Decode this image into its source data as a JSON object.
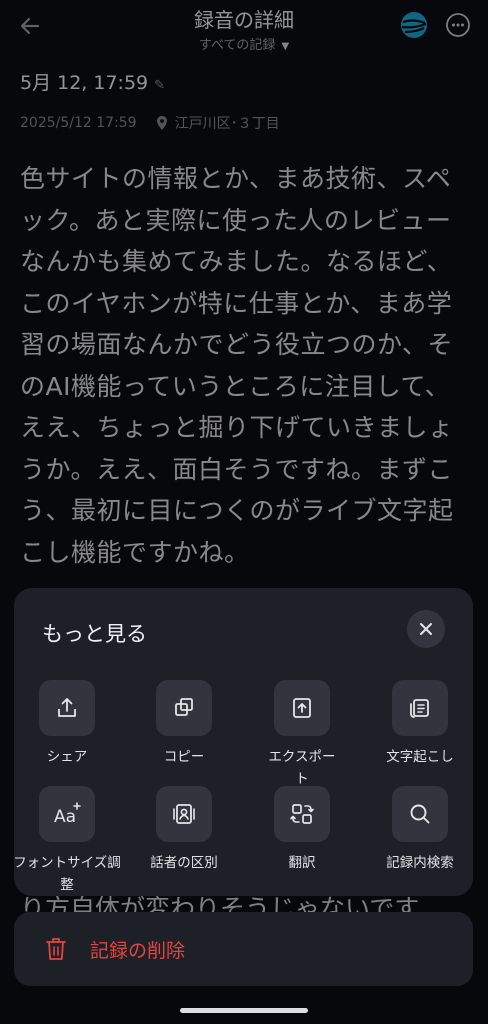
{
  "header": {
    "title": "録音の詳細",
    "subtitle": "すべての記録",
    "back_icon": "arrow-left-icon",
    "globe_icon": "globe-icon",
    "more_icon": "more-icon"
  },
  "record": {
    "title": "5月 12, 17:59",
    "timestamp": "2025/5/12 17:59",
    "location": "江戸川区･３丁目"
  },
  "transcript": {
    "text": "色サイトの情報とか、まあ技術、スペック。あと実際に使った人のレビューなんかも集めてみました。なるほど、このイヤホンが特に仕事とか、まあ学習の場面なんかでどう役立つのか、そのAI機能っていうところに注目して、ええ、ちょっと掘り下げていきましょうか。ええ、面白そうですね。まずこう、最初に目につくのがライブ文字起こし機能ですかね。",
    "partial_line": "り方自体が変わりそうじゃないです"
  },
  "sheet": {
    "title": "もっと見る",
    "actions": [
      {
        "label": "シェア",
        "icon": "share-icon"
      },
      {
        "label": "コピー",
        "icon": "copy-icon"
      },
      {
        "label": "エクスポート",
        "icon": "export-icon"
      },
      {
        "label": "文字起こし",
        "icon": "transcribe-icon"
      },
      {
        "label": "フォントサイズ調整",
        "icon": "font-size-icon"
      },
      {
        "label": "話者の区別",
        "icon": "speaker-icon"
      },
      {
        "label": "翻訳",
        "icon": "translate-icon"
      },
      {
        "label": "記録内検索",
        "icon": "search-icon"
      }
    ]
  },
  "delete": {
    "label": "記録の削除"
  },
  "colors": {
    "background": "#0c0d12",
    "sheet": "#1e2028",
    "tile": "#33353e",
    "danger": "#e2453e"
  }
}
